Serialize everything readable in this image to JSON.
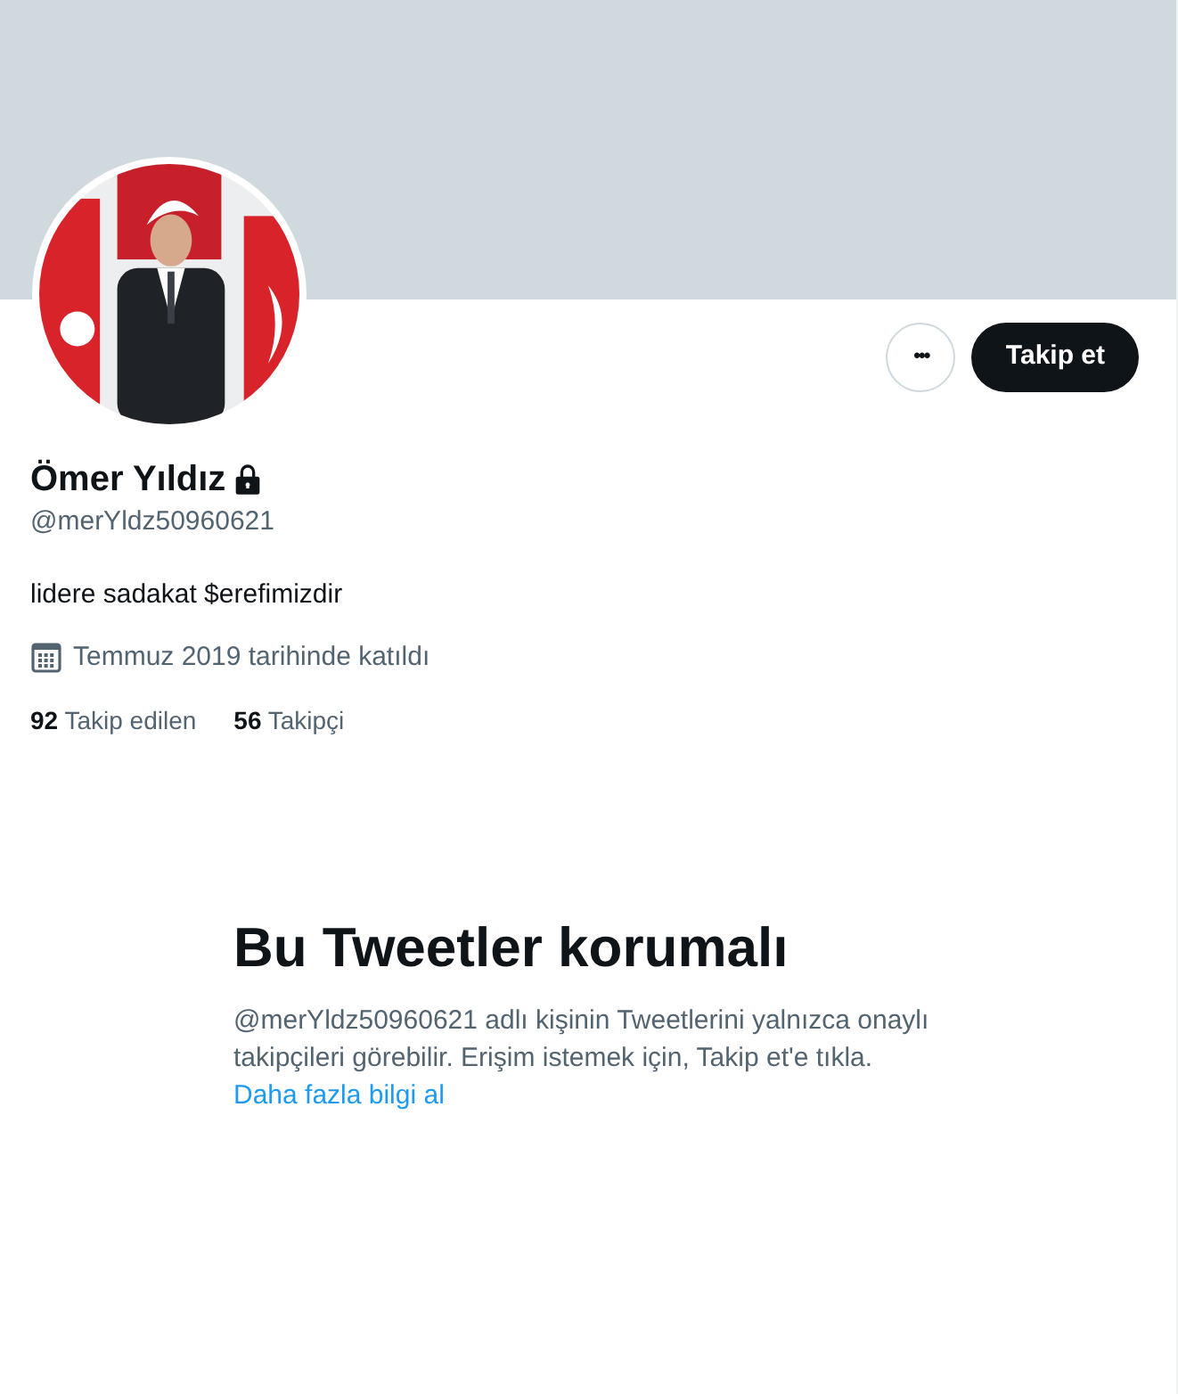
{
  "profile": {
    "actions": [
      {
        "kind": "more",
        "label": "•••"
      },
      {
        "kind": "follow",
        "label": "Takip et"
      }
    ],
    "name": "Ömer Yıldız",
    "protected": true,
    "handle": "@merYldz50960621",
    "bio": "lidere sadakat $erefimizdir",
    "joined": "Temmuz 2019 tarihinde katıldı",
    "stats": [
      {
        "count": "92",
        "label": "Takip edilen"
      },
      {
        "count": "56",
        "label": "Takipçi"
      }
    ]
  },
  "protected_notice": {
    "title": "Bu Tweetler korumalı",
    "text": "@merYldz50960621 adlı kişinin Tweetlerini yalnızca onaylı takipçileri görebilir. Erişim istemek için, Takip et'e tıkla.",
    "link": "Daha fazla bilgi al"
  }
}
